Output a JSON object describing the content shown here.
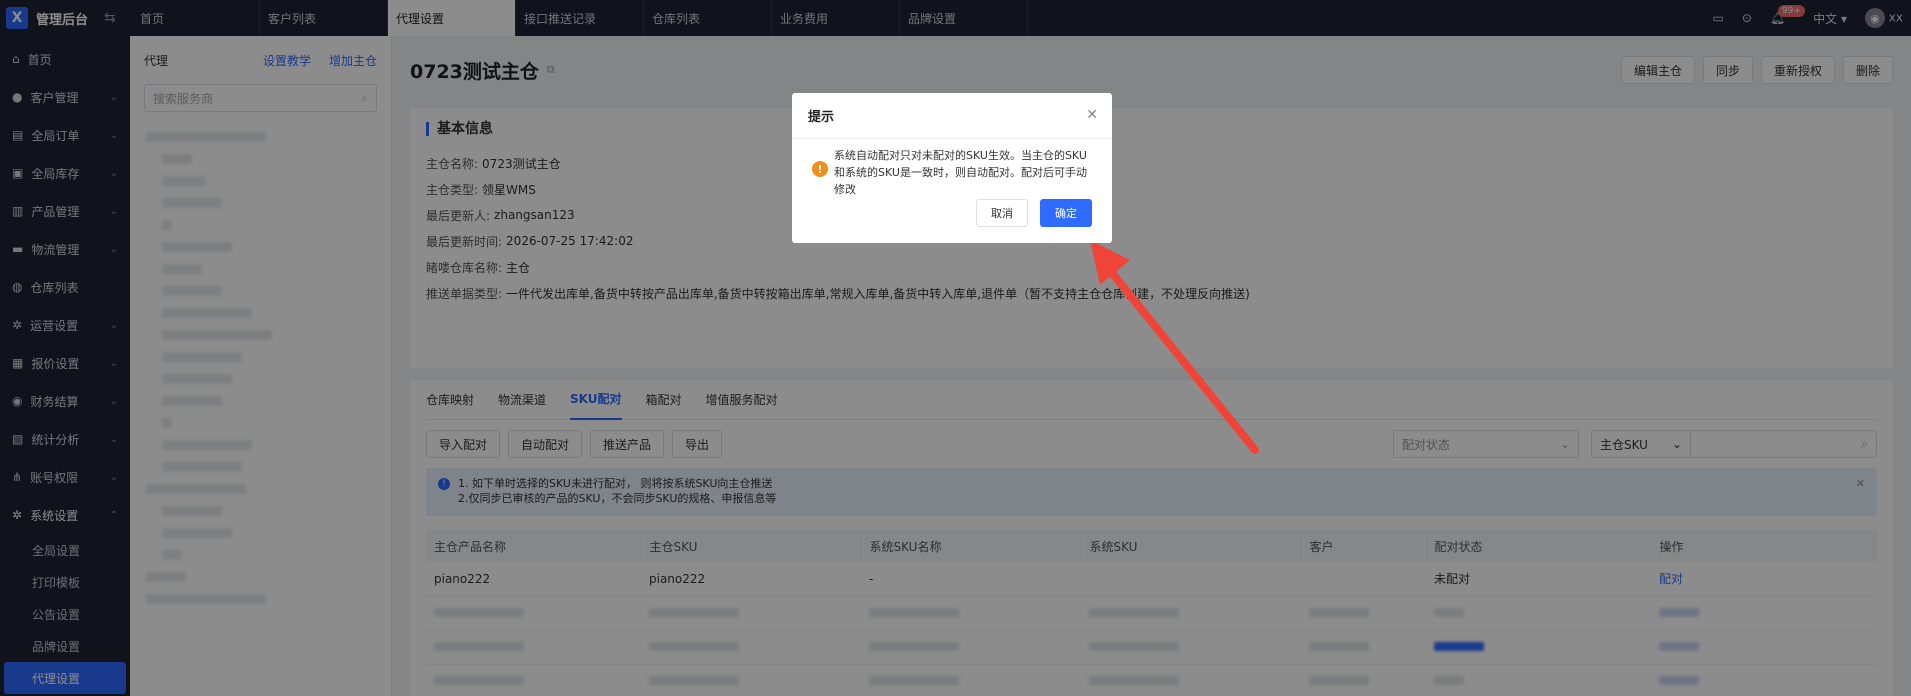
{
  "app": {
    "title": "管理后台"
  },
  "top_tabs": [
    "首页",
    "客户列表",
    "代理设置",
    "接口推送记录",
    "仓库列表",
    "业务费用",
    "品牌设置"
  ],
  "header": {
    "notification_count": "99+",
    "language": "中文",
    "user": "xx"
  },
  "sidebar": {
    "items": [
      "首页",
      "客户管理",
      "全局订单",
      "全局库存",
      "产品管理",
      "物流管理",
      "仓库列表",
      "运营设置",
      "报价设置",
      "财务结算",
      "统计分析",
      "账号权限",
      "系统设置"
    ],
    "sub_items": [
      "全局设置",
      "打印模板",
      "公告设置",
      "品牌设置",
      "代理设置"
    ]
  },
  "agent_panel": {
    "title": "代理",
    "tutorial_link": "设置教学",
    "add_link": "增加主仓",
    "search_placeholder": "搜索服务商"
  },
  "page": {
    "title": "0723测试主仓",
    "buttons": [
      "编辑主仓",
      "同步",
      "重新授权",
      "删除"
    ]
  },
  "basic_info": {
    "section_title": "基本信息",
    "rows": [
      {
        "label": "主仓名称:",
        "value": "0723测试主仓"
      },
      {
        "label": "主仓类型:",
        "value": "领星WMS"
      },
      {
        "label": "最后更新人:",
        "value": "zhangsan123"
      },
      {
        "label": "最后更新时间:",
        "value": "2026-07-25 17:42:02"
      },
      {
        "label": "睹喽仓库名称:",
        "value": "主仓"
      },
      {
        "label": "推送单据类型:",
        "value": "一件代发出库单,备货中转按产品出库单,备货中转按箱出库单,常规入库单,备货中转入库单,退件单（暂不支持主仓仓库创建，不处理反向推送)"
      }
    ]
  },
  "sub_tabs": [
    "仓库映射",
    "物流渠道",
    "SKU配对",
    "箱配对",
    "增值服务配对"
  ],
  "toolbar": {
    "buttons": [
      "导入配对",
      "自动配对",
      "推送产品",
      "导出"
    ],
    "status_placeholder": "配对状态",
    "sku_type": "主仓SKU"
  },
  "notice": {
    "line1": "1. 如下单时选择的SKU未进行配对， 则将按系统SKU向主仓推送",
    "line2": "2.仅同步已审核的产品的SKU，不会同步SKU的规格、申报信息等"
  },
  "table": {
    "headers": [
      "主仓产品名称",
      "主仓SKU",
      "系统SKU名称",
      "系统SKU",
      "客户",
      "配对状态",
      "操作"
    ],
    "row": {
      "name": "piano222",
      "sku": "piano222",
      "sys_name": "-",
      "sys_sku": "",
      "customer": "",
      "status": "未配对",
      "action": "配对"
    }
  },
  "modal": {
    "title": "提示",
    "message": "系统自动配对只对未配对的SKU生效。当主仓的SKU和系统的SKU是一致时，则自动配对。配对后可手动修改",
    "cancel": "取消",
    "confirm": "确定"
  },
  "colors": {
    "accent": "#2f6bff",
    "warning": "#f28c1a",
    "annotation_arrow": "#f04438"
  }
}
